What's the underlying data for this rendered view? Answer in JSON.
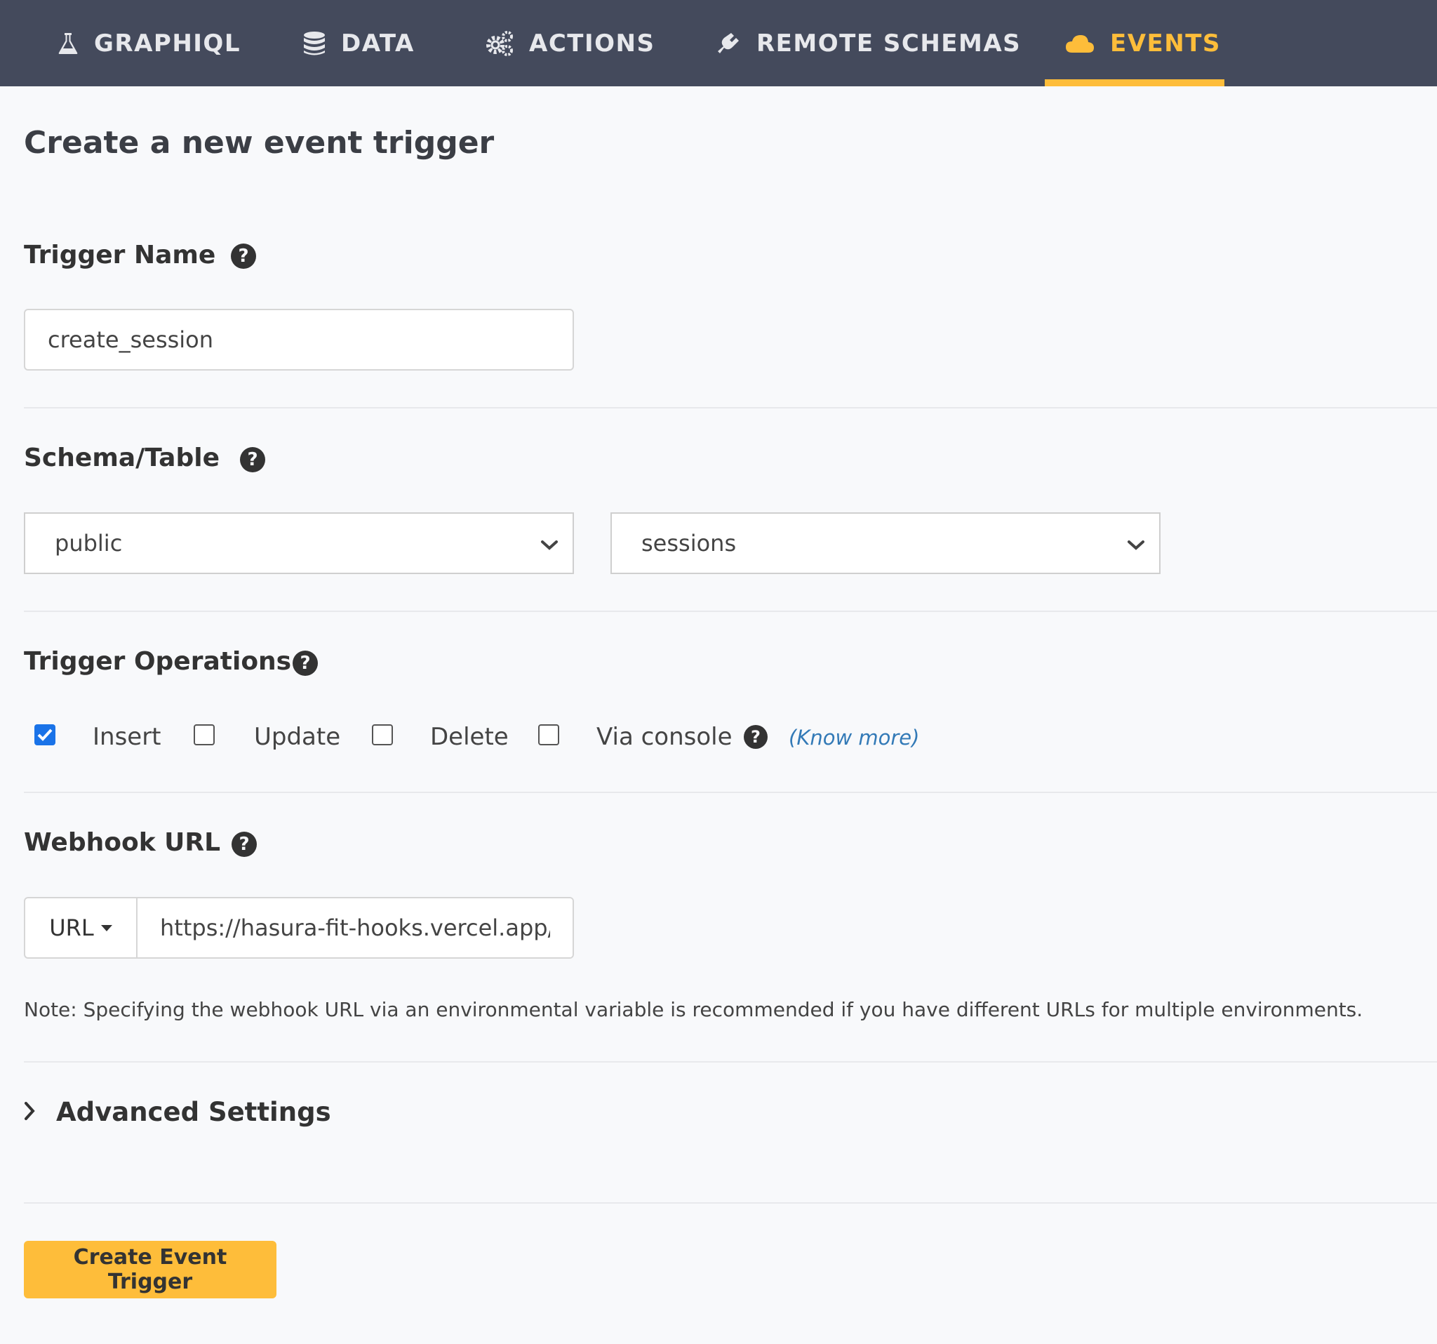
{
  "nav": {
    "tabs": [
      {
        "label": "GRAPHIQL",
        "icon": "flask-icon",
        "active": false
      },
      {
        "label": "DATA",
        "icon": "database-icon",
        "active": false
      },
      {
        "label": "ACTIONS",
        "icon": "cogs-icon",
        "active": false
      },
      {
        "label": "REMOTE SCHEMAS",
        "icon": "plug-icon",
        "active": false
      },
      {
        "label": "EVENTS",
        "icon": "cloud-icon",
        "active": true
      }
    ],
    "active_color": "#febd3a",
    "background": "#444a5c"
  },
  "page": {
    "title": "Create a new event trigger"
  },
  "trigger_name": {
    "label": "Trigger Name",
    "value": "create_session"
  },
  "schema_table": {
    "label": "Schema/Table",
    "schema": "public",
    "table": "sessions"
  },
  "operations": {
    "label": "Trigger Operations",
    "items": [
      {
        "label": "Insert",
        "checked": true
      },
      {
        "label": "Update",
        "checked": false
      },
      {
        "label": "Delete",
        "checked": false
      },
      {
        "label": "Via console",
        "checked": false
      }
    ],
    "know_more": "(Know more)"
  },
  "webhook": {
    "label": "Webhook URL",
    "type": "URL",
    "value": "https://hasura-fit-hooks.vercel.app/",
    "note": "Note: Specifying the webhook URL via an environmental variable is recommended if you have different URLs for multiple environments."
  },
  "advanced": {
    "label": "Advanced Settings"
  },
  "actions": {
    "create_label": "Create Event Trigger",
    "button_color": "#febd3a"
  },
  "help_glyph": "?"
}
